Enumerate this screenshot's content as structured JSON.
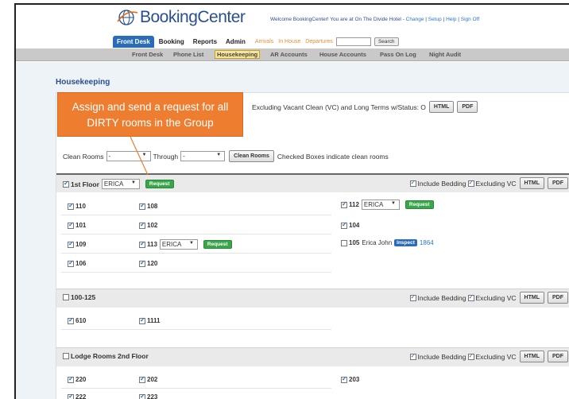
{
  "logo": {
    "pre": "Booking",
    "bold": "",
    "post": "Center"
  },
  "welcome": {
    "text": "Welcome BookingCenter! You are at On The Divide Hotel - ",
    "change": "Change",
    "setup": "Setup",
    "help": "Help",
    "signoff": "Sign Off",
    "sep": " | "
  },
  "topnav": {
    "tabs": [
      "Front Desk",
      "Booking",
      "Reports",
      "Admin"
    ],
    "ghosts": [
      "Arrivals",
      "In House",
      "Departures"
    ],
    "search_label": "Search"
  },
  "subnav": [
    "Front Desk",
    "Phone List",
    "Housekeeping",
    "AR Accounts",
    "House Accounts",
    "Pass On Log",
    "Night Audit"
  ],
  "page_title": "Housekeeping",
  "filter_text": "Excluding Vacant Clean (VC) and Long Terms w/Status: O",
  "html_label": "HTML",
  "pdf_label": "PDF",
  "clean": {
    "label": "Clean Rooms",
    "from": "-",
    "through_label": "Through",
    "to": "-",
    "button": "Clean Rooms",
    "note": "Checked Boxes indicate clean rooms"
  },
  "include_bedding": "Include Bedding",
  "excluding_vc": "Excluding VC",
  "request_label": "Request",
  "inspect_label": "Inspect",
  "groups": [
    {
      "name": "1st Floor",
      "assignee": "ERICA"
    },
    {
      "name": "100-125"
    },
    {
      "name": "Lodge Rooms 2nd Floor"
    }
  ],
  "rooms": {
    "g1": {
      "r110": "110",
      "r108": "108",
      "r112": "112",
      "r112_assignee": "ERICA",
      "r101": "101",
      "r102": "102",
      "r104": "104",
      "r109": "109",
      "r113": "113",
      "r113_assignee": "ERICA",
      "r105": "105",
      "r105_guest": "Erica John",
      "r105_ref": "1864",
      "r106": "106",
      "r120": "120"
    },
    "g2": {
      "r610": "610",
      "r1111": "1111"
    },
    "g3": {
      "r220": "220",
      "r202": "202",
      "r203": "203",
      "r222": "222",
      "r223": "223"
    }
  },
  "callout": {
    "line1": "Assign and send a request for all",
    "line2": "DIRTY rooms in the Group"
  },
  "colors": {
    "brand_blue": "#2b6cb8",
    "callout_orange": "#ee7d30",
    "request_green": "#39a64a"
  }
}
